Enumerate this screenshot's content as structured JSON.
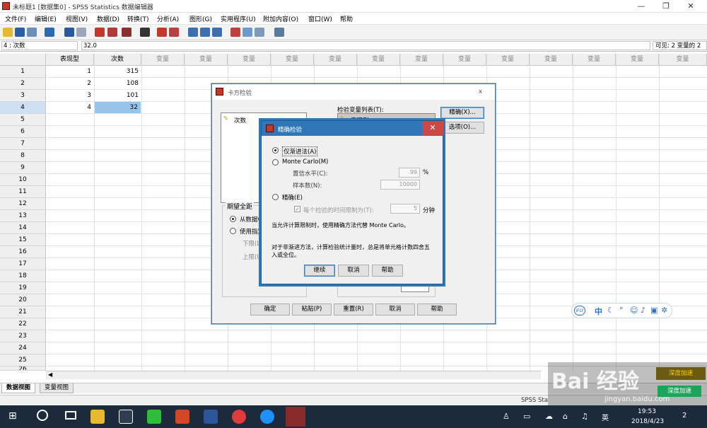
{
  "window": {
    "title": "未标题1 [数据集0] - SPSS Statistics 数据编辑器",
    "minimize": "—",
    "restore": "❐",
    "close": "✕"
  },
  "menu": [
    "文件(F)",
    "编辑(E)",
    "视图(V)",
    "数据(D)",
    "转换(T)",
    "分析(A)",
    "图形(G)",
    "实用程序(U)",
    "附加内容(O)",
    "窗口(W)",
    "帮助"
  ],
  "refbar": {
    "cell_ref": "4 : 次数",
    "cell_value": "32.0",
    "visible": "可见: 2 变量的 2"
  },
  "grid": {
    "columns": [
      "表现型",
      "次数",
      "变量",
      "变量",
      "变量",
      "变量",
      "变量",
      "变量",
      "变量",
      "变量",
      "变量",
      "变量",
      "变量",
      "变量",
      "变量"
    ],
    "rows": [
      {
        "num": "1",
        "a": "1",
        "b": "315"
      },
      {
        "num": "2",
        "a": "2",
        "b": "108"
      },
      {
        "num": "3",
        "a": "3",
        "b": "101"
      },
      {
        "num": "4",
        "a": "4",
        "b": "32"
      },
      {
        "num": "5"
      },
      {
        "num": "6"
      },
      {
        "num": "7"
      },
      {
        "num": "8"
      },
      {
        "num": "9"
      },
      {
        "num": "10"
      },
      {
        "num": "11"
      },
      {
        "num": "12"
      },
      {
        "num": "13"
      },
      {
        "num": "14"
      },
      {
        "num": "15"
      },
      {
        "num": "16"
      },
      {
        "num": "17"
      },
      {
        "num": "18"
      },
      {
        "num": "19"
      },
      {
        "num": "20"
      },
      {
        "num": "21"
      },
      {
        "num": "22"
      },
      {
        "num": "23"
      },
      {
        "num": "24"
      },
      {
        "num": "25"
      },
      {
        "num": "26"
      }
    ]
  },
  "sheet_tabs": {
    "data_view": "数据视图",
    "variable_view": "变量视图"
  },
  "status": {
    "processor": "SPSS Sta"
  },
  "chisq_dialog": {
    "title": "卡方检验",
    "close": "x",
    "source_list_item": "次数",
    "test_var_label": "检验变量列表(T):",
    "test_var_item": "表现型",
    "exact_button": "精确(X)...",
    "options_button": "选项(O)...",
    "expected_range_label": "期望全距",
    "from_data": "从数据中",
    "use_specified": "使用指定",
    "lower": "下限(L",
    "upper": "上限(U",
    "ok": "确定",
    "paste": "粘贴(P)",
    "reset": "重置(R)",
    "cancel": "取消",
    "help": "帮助"
  },
  "exact_dialog": {
    "title": "精确检验",
    "close": "✕",
    "asymptotic": "仅渐进法(A)",
    "monte_carlo": "Monte Carlo(M)",
    "confidence_label": "置信水平(C):",
    "confidence_value": "99",
    "confidence_unit": "%",
    "samples_label": "样本数(N):",
    "samples_value": "10000",
    "exact": "精确(E)",
    "time_limit_label": "每个检验的时间限制为(T):",
    "time_limit_value": "5",
    "time_limit_unit": "分钟",
    "note1": "当允许计算限制时，使用精确方法代替 Monte Carlo。",
    "note2": "对于非渐进方法，计算检验统计量时，总是将单元格计数四舍五入或全位。",
    "continue": "继续",
    "cancel": "取消",
    "help": "帮助"
  },
  "ime": {
    "logo": "iFLY",
    "lang": "中"
  },
  "watermark": {
    "logo": "Bai 经验",
    "url": "jingyan.baidu.com",
    "notify1": "深度加速",
    "notify2": "深度加速"
  },
  "taskbar": {
    "time": "19:53",
    "date": "2018/4/23",
    "lang": "英",
    "notif_count": "2"
  },
  "colors": {
    "dialog_title_blue": "#2f77b6",
    "selected_cell": "#99c4ea",
    "close_red": "#c94848",
    "taskbar": "#1c2a3b"
  }
}
